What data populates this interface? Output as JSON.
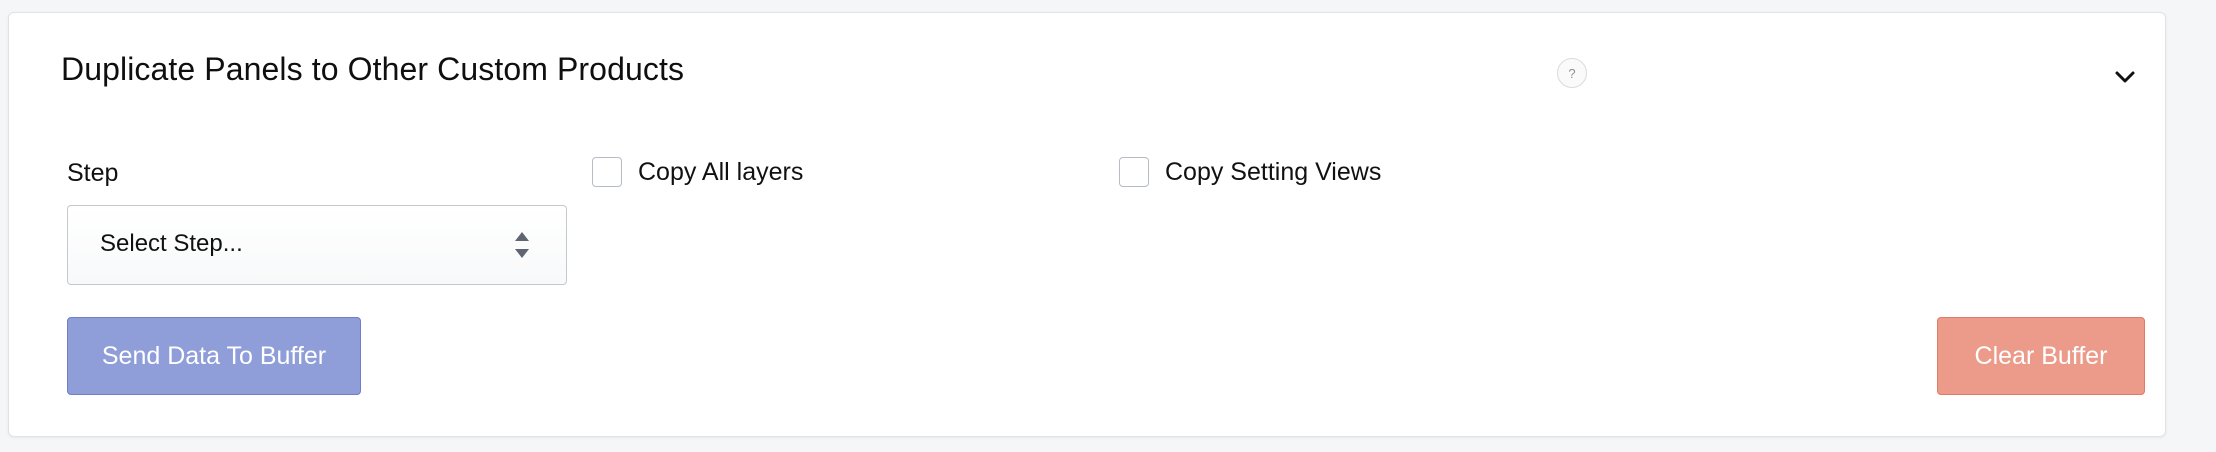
{
  "panel": {
    "title": "Duplicate Panels to Other Custom Products",
    "help_icon": "question-icon",
    "help_glyph": "?",
    "toggle_icon": "chevron-down-icon"
  },
  "form": {
    "step_label": "Step",
    "step_select_value": "Select Step...",
    "copy_all_layers_label": "Copy All layers",
    "copy_all_layers_checked": false,
    "copy_setting_views_label": "Copy Setting Views",
    "copy_setting_views_checked": false
  },
  "actions": {
    "send_label": "Send Data To Buffer",
    "clear_label": "Clear Buffer"
  },
  "colors": {
    "send_button": "#8f9dd8",
    "clear_button": "#ec9a89"
  }
}
